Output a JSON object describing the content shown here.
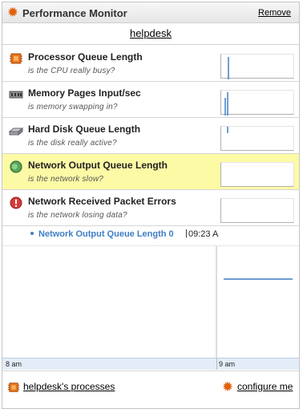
{
  "header": {
    "title": "Performance Monitor",
    "remove_label": "Remove"
  },
  "host": {
    "label": "helpdesk"
  },
  "metrics": [
    {
      "name": "Processor Queue Length",
      "desc": "is the CPU really busy?",
      "icon": "processor-chip-icon",
      "selected": false
    },
    {
      "name": "Memory Pages Input/sec",
      "desc": "is memory swapping in?",
      "icon": "memory-module-icon",
      "selected": false
    },
    {
      "name": "Hard Disk Queue Length",
      "desc": "is the disk really active?",
      "icon": "hard-disk-icon",
      "selected": false
    },
    {
      "name": "Network Output Queue Length",
      "desc": "is the network slow?",
      "icon": "network-globe-icon",
      "selected": true
    },
    {
      "name": "Network Received Packet Errors",
      "desc": "is the network losing data?",
      "icon": "error-icon",
      "selected": false
    }
  ],
  "legend": {
    "series_label": "Network Output Queue Length 0",
    "time": "09:23 A"
  },
  "timeline": {
    "left_label": "8 am",
    "right_label": "9 am"
  },
  "footer": {
    "processes_label": "helpdesk's processes",
    "configure_label": "configure me"
  },
  "colors": {
    "accent": "#e0620d",
    "series": "#3f7fc4",
    "selected_row": "#fdfaa6",
    "axis_band": "#e4edf7"
  }
}
